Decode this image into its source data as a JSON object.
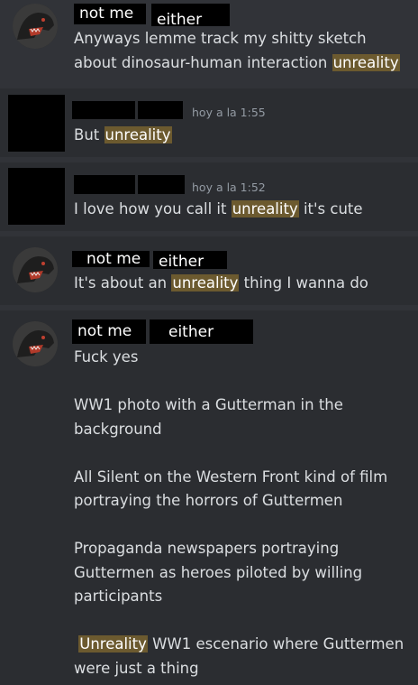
{
  "messages": [
    {
      "author": "not me",
      "author2": "either",
      "lines": [
        "Anyways lemme track my shitty sketch",
        {
          "pre": "about dinosaur-human interaction ",
          "hl": "unreality",
          "post": ""
        }
      ]
    },
    {
      "time": "hoy a la 1:55",
      "lines": [
        {
          "pre": "But ",
          "hl": "unreality",
          "post": ""
        }
      ]
    },
    {
      "time": "hoy a la 1:52",
      "lines": [
        {
          "pre": "I love how you call it ",
          "hl": "unreality",
          "post": " it's cute"
        }
      ]
    },
    {
      "author": "not me",
      "author2": "either",
      "lines": [
        {
          "pre": "It's about an ",
          "hl": "unreality",
          "post": " thing I wanna do"
        }
      ]
    },
    {
      "author": "not me",
      "author2": "either",
      "lines": [
        "Fuck yes",
        "",
        "WW1 photo with a Gutterman in the",
        "background",
        "",
        "All Silent on the Western Front  kind of film",
        "portraying the horrors of Guttermen",
        "",
        "Propaganda newspapers portraying",
        "Guttermen as heroes piloted by willing",
        "participants",
        "",
        {
          "pre": "",
          "hl": "Unreality",
          "post": " WW1 escenario where Guttermen"
        },
        "were just a thing"
      ]
    }
  ]
}
